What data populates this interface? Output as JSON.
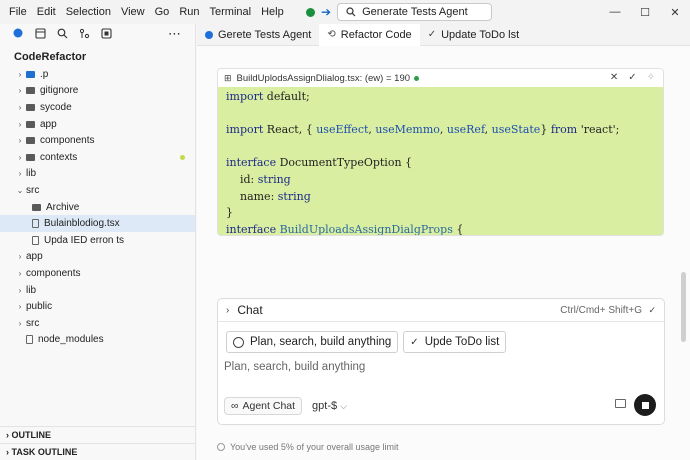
{
  "menu": [
    "File",
    "Edit",
    "Selection",
    "View",
    "Go",
    "Run",
    "Terminal",
    "Help"
  ],
  "command_center": {
    "label": "Generate Tests Agent"
  },
  "window_controls": {
    "minimize": "—",
    "maximize": "☐",
    "close": "✕"
  },
  "sidebar": {
    "project": "CodeRefactor",
    "tree": [
      {
        "label": ".p",
        "kind": "folder",
        "chevron": true,
        "accent": "blue"
      },
      {
        "label": "gitignore",
        "kind": "folder",
        "chevron": true
      },
      {
        "label": "sycode",
        "kind": "folder",
        "chevron": true
      },
      {
        "label": "app",
        "kind": "folder",
        "chevron": true
      },
      {
        "label": "components",
        "kind": "folder",
        "chevron": true
      },
      {
        "label": "contexts",
        "kind": "folder",
        "chevron": true,
        "modified": true
      },
      {
        "label": "lib",
        "kind": "plain",
        "chevron": true
      },
      {
        "label": "src",
        "kind": "plain",
        "chevron": "open"
      },
      {
        "label": "Archive",
        "kind": "folder",
        "indent": true
      },
      {
        "label": "Bulainblodiog.tsx",
        "kind": "file",
        "indent": true,
        "selected": true
      },
      {
        "label": "Upda IED erron ts",
        "kind": "file",
        "indent": true
      },
      {
        "label": "app",
        "kind": "plain",
        "chevron": true
      },
      {
        "label": "components",
        "kind": "plain",
        "chevron": true
      },
      {
        "label": "lib",
        "kind": "plain",
        "chevron": true
      },
      {
        "label": "public",
        "kind": "plain",
        "chevron": true
      },
      {
        "label": "src",
        "kind": "plain",
        "chevron": true
      },
      {
        "label": "node_modules",
        "kind": "file"
      }
    ],
    "outline": "OUTLINE",
    "task_outline": "TASK OUTLINE"
  },
  "tabs": [
    {
      "label": "Gerete Tests Agent",
      "icon": "agent-dot-icon",
      "active": false
    },
    {
      "label": "Refactor Code",
      "icon": "refactor-icon",
      "active": true
    },
    {
      "label": "Update ToDo lst",
      "icon": "check-icon",
      "active": false
    }
  ],
  "code_card": {
    "title": "BuildUplodsAssignDlialog.tsx: (ew) = 190",
    "lines": [
      "import default;",
      "",
      "import React, { useEffect, useMemmo, useRef, useState} from 'react';",
      "",
      "interface DocumentTypeOption {",
      "    id: string",
      "    name: string",
      "}",
      "interface BuildUploadsAssignDialgProps {"
    ]
  },
  "chat": {
    "title": "Chat",
    "shortcut": "Ctrl/Cmd+ Shift+G",
    "chip_plan": "Plan, search, build anything",
    "chip_todo": "Upde ToDo list",
    "placeholder": "Plan, search, build anything",
    "agent_label": "Agent Chat",
    "model": "gpt-$"
  },
  "usage_text": "You've used 5% of your overall usage limit"
}
